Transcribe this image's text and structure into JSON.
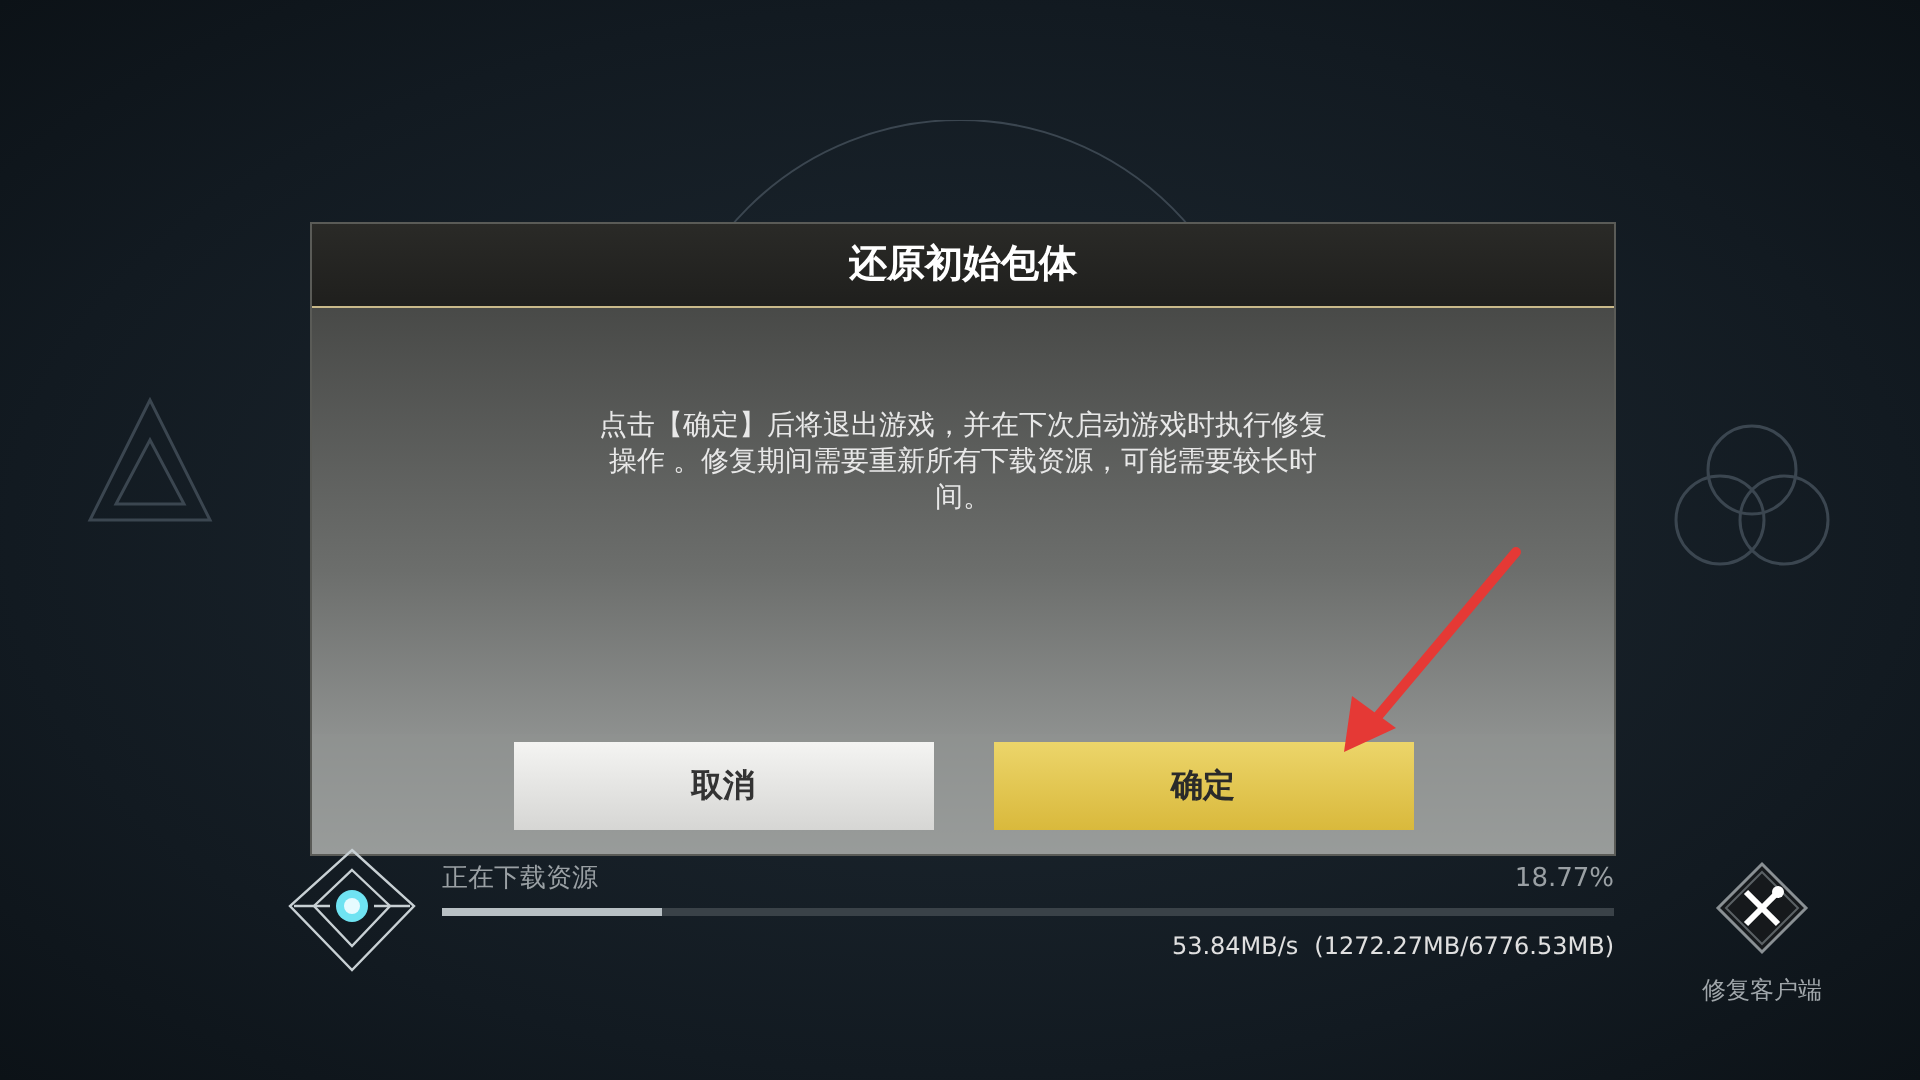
{
  "dialog": {
    "title": "还原初始包体",
    "message": "点击【确定】后将退出游戏，并在下次启动游戏时执行修复操作 。修复期间需要重新所有下载资源，可能需要较长时间。",
    "buttons": [
      {
        "label": "取消",
        "kind": "secondary"
      },
      {
        "label": "确定",
        "kind": "primary"
      }
    ]
  },
  "download": {
    "label": "正在下载资源",
    "percent": "18.77%",
    "level": 0.1877,
    "speed": "53.84MB/s",
    "size": "(1272.27MB/6776.53MB)"
  },
  "repair": {
    "label": "修复客户端"
  }
}
